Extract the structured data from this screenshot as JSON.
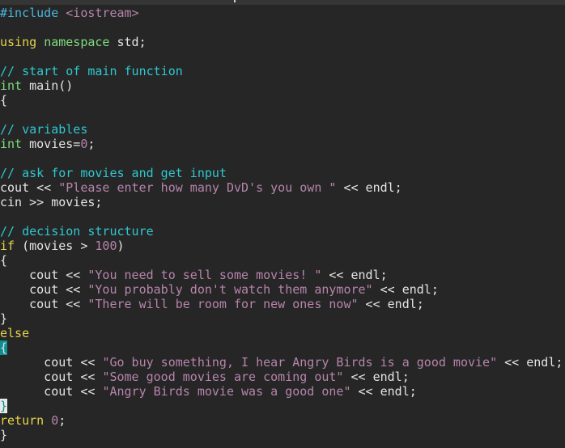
{
  "editor": {
    "colors": {
      "background": "#262626",
      "keyword": "#e6d34a",
      "type": "#7fdc7f",
      "string": "#b784ac",
      "comment": "#2ec8d0",
      "preprocessor": "#48b6df",
      "match_highlight": "#0c8e92"
    },
    "lines": [
      [
        {
          "t": "#include",
          "c": "pre"
        },
        {
          "t": " "
        },
        {
          "t": "<iostream>",
          "c": "inc"
        }
      ],
      [],
      [
        {
          "t": "using",
          "c": "kw"
        },
        {
          "t": " "
        },
        {
          "t": "namespace",
          "c": "type"
        },
        {
          "t": " std;"
        }
      ],
      [],
      [
        {
          "t": "// start of main function",
          "c": "cmt"
        }
      ],
      [
        {
          "t": "int",
          "c": "type"
        },
        {
          "t": " main()"
        }
      ],
      [
        {
          "t": "{"
        }
      ],
      [],
      [
        {
          "t": "// variables",
          "c": "cmt"
        }
      ],
      [
        {
          "t": "int",
          "c": "type"
        },
        {
          "t": " movies="
        },
        {
          "t": "0",
          "c": "num"
        },
        {
          "t": ";"
        }
      ],
      [],
      [
        {
          "t": "// ask for movies and get input",
          "c": "cmt"
        }
      ],
      [
        {
          "t": "cout << "
        },
        {
          "t": "\"Please enter how many DvD's you own \"",
          "c": "str"
        },
        {
          "t": " << endl;"
        }
      ],
      [
        {
          "t": "cin >> movies;"
        }
      ],
      [],
      [
        {
          "t": "// decision structure",
          "c": "cmt"
        }
      ],
      [
        {
          "t": "if",
          "c": "kw"
        },
        {
          "t": " (movies > "
        },
        {
          "t": "100",
          "c": "num"
        },
        {
          "t": ")"
        }
      ],
      [
        {
          "t": "{"
        }
      ],
      [
        {
          "t": "    cout << "
        },
        {
          "t": "\"You need to sell some movies! \"",
          "c": "str"
        },
        {
          "t": " << endl;"
        }
      ],
      [
        {
          "t": "    cout << "
        },
        {
          "t": "\"You probably don't watch them anymore\"",
          "c": "str"
        },
        {
          "t": " << endl;"
        }
      ],
      [
        {
          "t": "    cout << "
        },
        {
          "t": "\"There will be room for new ones now\"",
          "c": "str"
        },
        {
          "t": " << endl;"
        }
      ],
      [
        {
          "t": "}"
        }
      ],
      [
        {
          "t": "else",
          "c": "kw"
        }
      ],
      [
        {
          "t": "{",
          "c": "match"
        }
      ],
      [
        {
          "t": "      cout << "
        },
        {
          "t": "\"Go buy something, I hear Angry Birds is a good movie\"",
          "c": "str"
        },
        {
          "t": " << endl;"
        }
      ],
      [
        {
          "t": "      cout << "
        },
        {
          "t": "\"Some good movies are coming out\"",
          "c": "str"
        },
        {
          "t": " << endl;"
        }
      ],
      [
        {
          "t": "      cout << "
        },
        {
          "t": "\"Angry Birds movie was a good one\"",
          "c": "str"
        },
        {
          "t": " << endl;"
        }
      ],
      [
        {
          "t": "}",
          "c": "cursor"
        }
      ],
      [
        {
          "t": "return",
          "c": "kw"
        },
        {
          "t": " "
        },
        {
          "t": "0",
          "c": "num"
        },
        {
          "t": ";"
        }
      ],
      [
        {
          "t": "}"
        }
      ]
    ]
  }
}
